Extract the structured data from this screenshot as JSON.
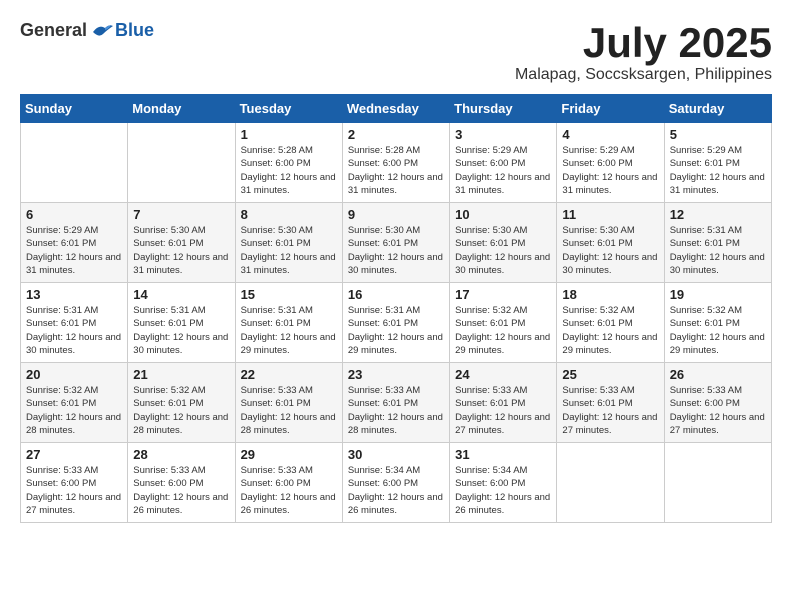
{
  "logo": {
    "general": "General",
    "blue": "Blue"
  },
  "title": {
    "month": "July 2025",
    "location": "Malapag, Soccsksargen, Philippines"
  },
  "weekdays": [
    "Sunday",
    "Monday",
    "Tuesday",
    "Wednesday",
    "Thursday",
    "Friday",
    "Saturday"
  ],
  "weeks": [
    [
      {
        "day": "",
        "info": ""
      },
      {
        "day": "",
        "info": ""
      },
      {
        "day": "1",
        "info": "Sunrise: 5:28 AM\nSunset: 6:00 PM\nDaylight: 12 hours and 31 minutes."
      },
      {
        "day": "2",
        "info": "Sunrise: 5:28 AM\nSunset: 6:00 PM\nDaylight: 12 hours and 31 minutes."
      },
      {
        "day": "3",
        "info": "Sunrise: 5:29 AM\nSunset: 6:00 PM\nDaylight: 12 hours and 31 minutes."
      },
      {
        "day": "4",
        "info": "Sunrise: 5:29 AM\nSunset: 6:00 PM\nDaylight: 12 hours and 31 minutes."
      },
      {
        "day": "5",
        "info": "Sunrise: 5:29 AM\nSunset: 6:01 PM\nDaylight: 12 hours and 31 minutes."
      }
    ],
    [
      {
        "day": "6",
        "info": "Sunrise: 5:29 AM\nSunset: 6:01 PM\nDaylight: 12 hours and 31 minutes."
      },
      {
        "day": "7",
        "info": "Sunrise: 5:30 AM\nSunset: 6:01 PM\nDaylight: 12 hours and 31 minutes."
      },
      {
        "day": "8",
        "info": "Sunrise: 5:30 AM\nSunset: 6:01 PM\nDaylight: 12 hours and 31 minutes."
      },
      {
        "day": "9",
        "info": "Sunrise: 5:30 AM\nSunset: 6:01 PM\nDaylight: 12 hours and 30 minutes."
      },
      {
        "day": "10",
        "info": "Sunrise: 5:30 AM\nSunset: 6:01 PM\nDaylight: 12 hours and 30 minutes."
      },
      {
        "day": "11",
        "info": "Sunrise: 5:30 AM\nSunset: 6:01 PM\nDaylight: 12 hours and 30 minutes."
      },
      {
        "day": "12",
        "info": "Sunrise: 5:31 AM\nSunset: 6:01 PM\nDaylight: 12 hours and 30 minutes."
      }
    ],
    [
      {
        "day": "13",
        "info": "Sunrise: 5:31 AM\nSunset: 6:01 PM\nDaylight: 12 hours and 30 minutes."
      },
      {
        "day": "14",
        "info": "Sunrise: 5:31 AM\nSunset: 6:01 PM\nDaylight: 12 hours and 30 minutes."
      },
      {
        "day": "15",
        "info": "Sunrise: 5:31 AM\nSunset: 6:01 PM\nDaylight: 12 hours and 29 minutes."
      },
      {
        "day": "16",
        "info": "Sunrise: 5:31 AM\nSunset: 6:01 PM\nDaylight: 12 hours and 29 minutes."
      },
      {
        "day": "17",
        "info": "Sunrise: 5:32 AM\nSunset: 6:01 PM\nDaylight: 12 hours and 29 minutes."
      },
      {
        "day": "18",
        "info": "Sunrise: 5:32 AM\nSunset: 6:01 PM\nDaylight: 12 hours and 29 minutes."
      },
      {
        "day": "19",
        "info": "Sunrise: 5:32 AM\nSunset: 6:01 PM\nDaylight: 12 hours and 29 minutes."
      }
    ],
    [
      {
        "day": "20",
        "info": "Sunrise: 5:32 AM\nSunset: 6:01 PM\nDaylight: 12 hours and 28 minutes."
      },
      {
        "day": "21",
        "info": "Sunrise: 5:32 AM\nSunset: 6:01 PM\nDaylight: 12 hours and 28 minutes."
      },
      {
        "day": "22",
        "info": "Sunrise: 5:33 AM\nSunset: 6:01 PM\nDaylight: 12 hours and 28 minutes."
      },
      {
        "day": "23",
        "info": "Sunrise: 5:33 AM\nSunset: 6:01 PM\nDaylight: 12 hours and 28 minutes."
      },
      {
        "day": "24",
        "info": "Sunrise: 5:33 AM\nSunset: 6:01 PM\nDaylight: 12 hours and 27 minutes."
      },
      {
        "day": "25",
        "info": "Sunrise: 5:33 AM\nSunset: 6:01 PM\nDaylight: 12 hours and 27 minutes."
      },
      {
        "day": "26",
        "info": "Sunrise: 5:33 AM\nSunset: 6:00 PM\nDaylight: 12 hours and 27 minutes."
      }
    ],
    [
      {
        "day": "27",
        "info": "Sunrise: 5:33 AM\nSunset: 6:00 PM\nDaylight: 12 hours and 27 minutes."
      },
      {
        "day": "28",
        "info": "Sunrise: 5:33 AM\nSunset: 6:00 PM\nDaylight: 12 hours and 26 minutes."
      },
      {
        "day": "29",
        "info": "Sunrise: 5:33 AM\nSunset: 6:00 PM\nDaylight: 12 hours and 26 minutes."
      },
      {
        "day": "30",
        "info": "Sunrise: 5:34 AM\nSunset: 6:00 PM\nDaylight: 12 hours and 26 minutes."
      },
      {
        "day": "31",
        "info": "Sunrise: 5:34 AM\nSunset: 6:00 PM\nDaylight: 12 hours and 26 minutes."
      },
      {
        "day": "",
        "info": ""
      },
      {
        "day": "",
        "info": ""
      }
    ]
  ]
}
